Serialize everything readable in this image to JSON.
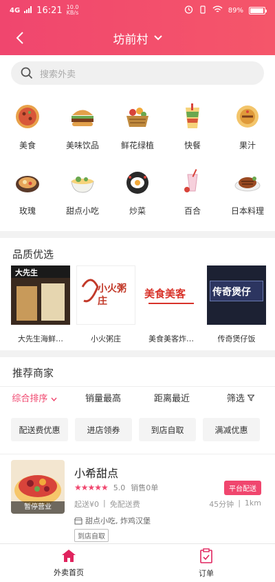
{
  "status_bar": {
    "network": "4G",
    "time": "16:21",
    "speed_top": "10.0",
    "speed_unit": "KB/s",
    "battery": "89%"
  },
  "header": {
    "title": "坊前村",
    "back_icon": "chevron-left-icon",
    "dropdown_icon": "chevron-down-icon"
  },
  "search": {
    "placeholder": "搜索外卖"
  },
  "categories": [
    {
      "label": "美食",
      "icon": "pizza-icon"
    },
    {
      "label": "美味饮品",
      "icon": "burger-icon"
    },
    {
      "label": "鲜花绿植",
      "icon": "fruit-basket-icon"
    },
    {
      "label": "快餐",
      "icon": "drink-cup-icon"
    },
    {
      "label": "果汁",
      "icon": "pancake-icon"
    },
    {
      "label": "玫瑰",
      "icon": "hotpot-icon"
    },
    {
      "label": "甜点小吃",
      "icon": "noodle-bowl-icon"
    },
    {
      "label": "炒菜",
      "icon": "fried-egg-pan-icon"
    },
    {
      "label": "百合",
      "icon": "milkshake-icon"
    },
    {
      "label": "日本料理",
      "icon": "steak-icon"
    }
  ],
  "quality": {
    "title": "品质优选",
    "items": [
      {
        "label": "大先生海鲜…",
        "sign": "大先生",
        "bg": "#3a2a1f"
      },
      {
        "label": "小火粥庄",
        "sign": "小火粥庄",
        "bg": "#ffffff"
      },
      {
        "label": "美食美客炸…",
        "sign": "美食美客",
        "bg": "#ffffff"
      },
      {
        "label": "传奇煲仔饭",
        "sign": "传奇煲仔",
        "bg": "#1c2133"
      }
    ]
  },
  "recommend": {
    "title": "推荐商家",
    "sort": [
      {
        "label": "综合排序",
        "active": true
      },
      {
        "label": "销量最高"
      },
      {
        "label": "距离最近"
      },
      {
        "label": "筛选"
      }
    ],
    "filters": [
      "配送费优惠",
      "进店领券",
      "到店自取",
      "满减优惠"
    ]
  },
  "shop": {
    "name": "小希甜点",
    "status": "暂停营业",
    "rating": "5.0",
    "sales": "销售0单",
    "badge": "平台配送",
    "min_order": "起送¥0",
    "delivery_fee": "免配送费",
    "time": "45分钟",
    "distance": "1km",
    "tags": "甜点小吃, 炸鸡汉堡",
    "pickup": "到店自取"
  },
  "tabbar": [
    {
      "label": "外卖首页",
      "icon": "home-icon",
      "active": true
    },
    {
      "label": "订单",
      "icon": "order-clipboard-icon"
    }
  ],
  "colors": {
    "brand": "#f0466e"
  }
}
